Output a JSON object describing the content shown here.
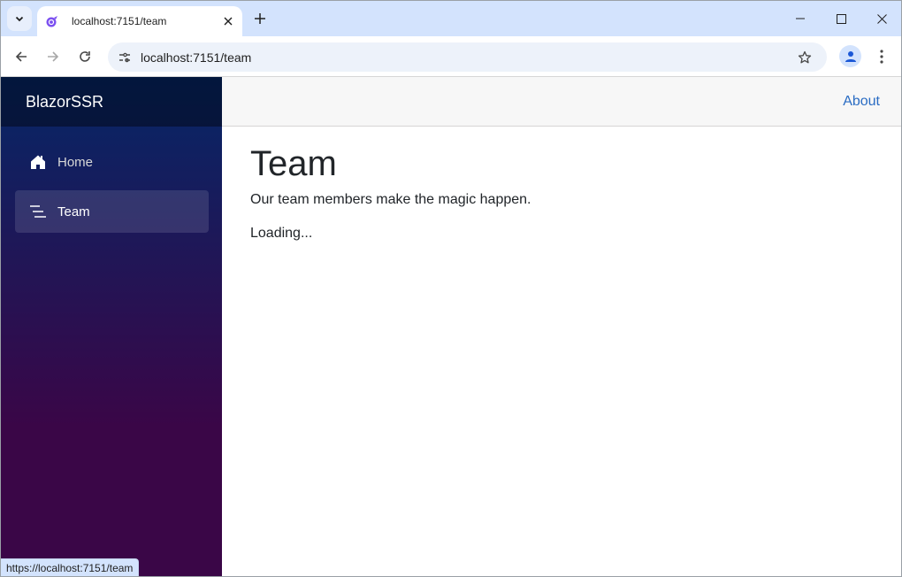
{
  "browser": {
    "tab": {
      "title": "localhost:7151/team",
      "favicon": "blazor-icon"
    },
    "new_tab_label": "+",
    "address_bar": {
      "url": "localhost:7151/team"
    },
    "icons": {
      "tab_search": "chevron-down-icon",
      "close_tab": "close-icon",
      "minimize": "minimize-icon",
      "maximize": "maximize-icon",
      "close_window": "close-icon",
      "back": "arrow-left-icon",
      "forward": "arrow-right-icon",
      "reload": "reload-icon",
      "site_info": "tune-icon",
      "bookmark": "star-icon",
      "profile": "person-icon",
      "menu": "more-vertical-icon"
    },
    "status_url": "https://localhost:7151/team"
  },
  "app": {
    "brand": "BlazorSSR",
    "nav": [
      {
        "label": "Home",
        "icon": "home-icon",
        "active": false
      },
      {
        "label": "Team",
        "icon": "list-icon",
        "active": true
      }
    ],
    "top_row": {
      "about_link": "About"
    },
    "content": {
      "title": "Team",
      "lead": "Our team members make the magic happen.",
      "status": "Loading..."
    }
  }
}
